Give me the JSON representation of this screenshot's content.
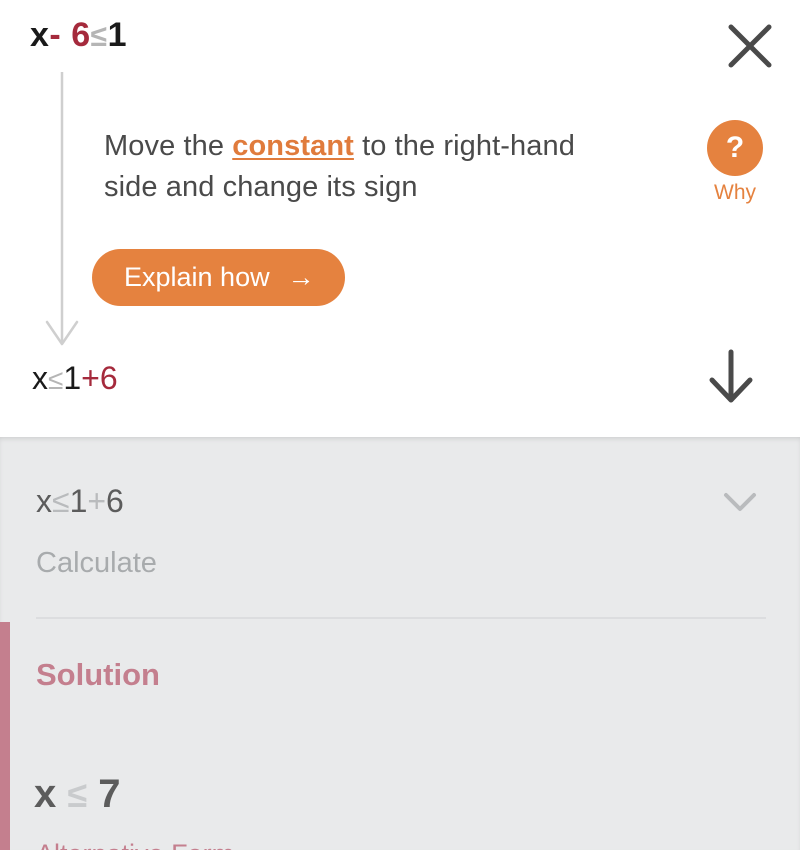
{
  "hint": {
    "equation_top": {
      "variable": "x",
      "operator_term": "- 6",
      "relation": "≤",
      "right": "1"
    },
    "instruction": {
      "before": "Move the ",
      "keyword": "constant",
      "after": " to the right-hand side and change its sign"
    },
    "why": {
      "icon_label": "?",
      "label": "Why"
    },
    "explain_button": {
      "label": "Explain how",
      "arrow": "→"
    },
    "equation_result": {
      "variable": "x",
      "relation": "≤",
      "right": "1",
      "added": "+6"
    },
    "close_label": "✕",
    "next_step_arrow": "↓"
  },
  "solver": {
    "step": {
      "variable": "x",
      "relation": "≤",
      "right": "1",
      "plus": "+",
      "addend": "6"
    },
    "action_label": "Calculate",
    "chevron": "⌄",
    "solution_title": "Solution",
    "solution": {
      "variable": "x",
      "relation": "≤",
      "value": "7"
    },
    "cut_off_text": "Alternative Form"
  },
  "colors": {
    "orange": "#e5823f",
    "crimson": "#a52a3c",
    "rose": "#c47f8e",
    "panel_gray": "#e9eaeb",
    "text_gray": "#4a4a4a",
    "muted_gray": "#b5b5b5"
  }
}
